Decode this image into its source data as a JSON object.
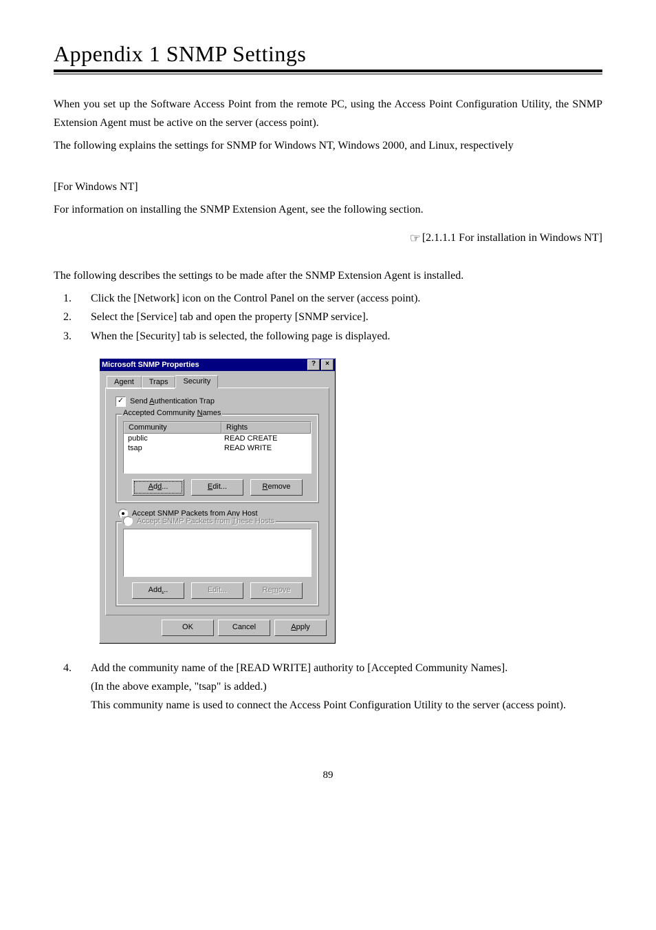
{
  "title": "Appendix 1  SNMP Settings",
  "intro_p1": "When you set up the Software Access Point from the remote PC, using the Access Point Configuration Utility, the SNMP Extension Agent must be active on the server (access point).",
  "intro_p2": "The following explains the settings for SNMP for Windows NT, Windows 2000, and Linux, respectively",
  "nt_heading": "[For Windows NT]",
  "nt_p1": "For information on installing the SNMP Extension Agent, see the following section.",
  "ref_text": "[2.1.1.1  For installation in Windows NT]",
  "after_install": "The following describes the settings to be made after the SNMP Extension Agent is installed.",
  "steps_a": [
    "Click the [Network] icon on the Control Panel on the server (access point).",
    "Select the [Service] tab and open the property [SNMP service].",
    "When the [Security] tab is selected, the following page is displayed."
  ],
  "step4_num": "4.",
  "step4_l1": "Add the community name of the [READ WRITE] authority to [Accepted Community Names].",
  "step4_l2": "(In the above example, \"tsap\" is added.)",
  "step4_l3": "This community name is used to connect the Access Point Configuration Utility to the server (access point).",
  "page_number": "89",
  "dialog": {
    "title": "Microsoft SNMP Properties",
    "help_btn": "?",
    "close_btn": "×",
    "tabs": {
      "agent": "Agent",
      "traps": "Traps",
      "security": "Security"
    },
    "send_auth_trap_pre": "Send ",
    "send_auth_trap_u": "A",
    "send_auth_trap_post": "uthentication Trap",
    "group1_pre": "Accepted Community ",
    "group1_u": "N",
    "group1_post": "ames",
    "col_community": "Community",
    "col_rights": "Rights",
    "rows": [
      {
        "c": "public",
        "r": "READ CREATE"
      },
      {
        "c": "tsap",
        "r": "READ WRITE"
      }
    ],
    "btn_add": "Add...",
    "btn_edit_u": "E",
    "btn_edit_post": "dit...",
    "btn_remove_u": "R",
    "btn_remove_post": "emove",
    "radio1_pre": "A",
    "radio1_u": "c",
    "radio1_post": "cept SNMP Packets from Any Host",
    "radio2_pre": "Accept SNMP Packets from ",
    "radio2_u": "T",
    "radio2_post": "hese Hosts",
    "btn_add2": "Add...",
    "btn_edit2": "Edit...",
    "btn_remove2_pre": "Re",
    "btn_remove2_u": "m",
    "btn_remove2_post": "ove",
    "btn_ok": "OK",
    "btn_cancel": "Cancel",
    "btn_apply_u": "A",
    "btn_apply_post": "pply"
  }
}
